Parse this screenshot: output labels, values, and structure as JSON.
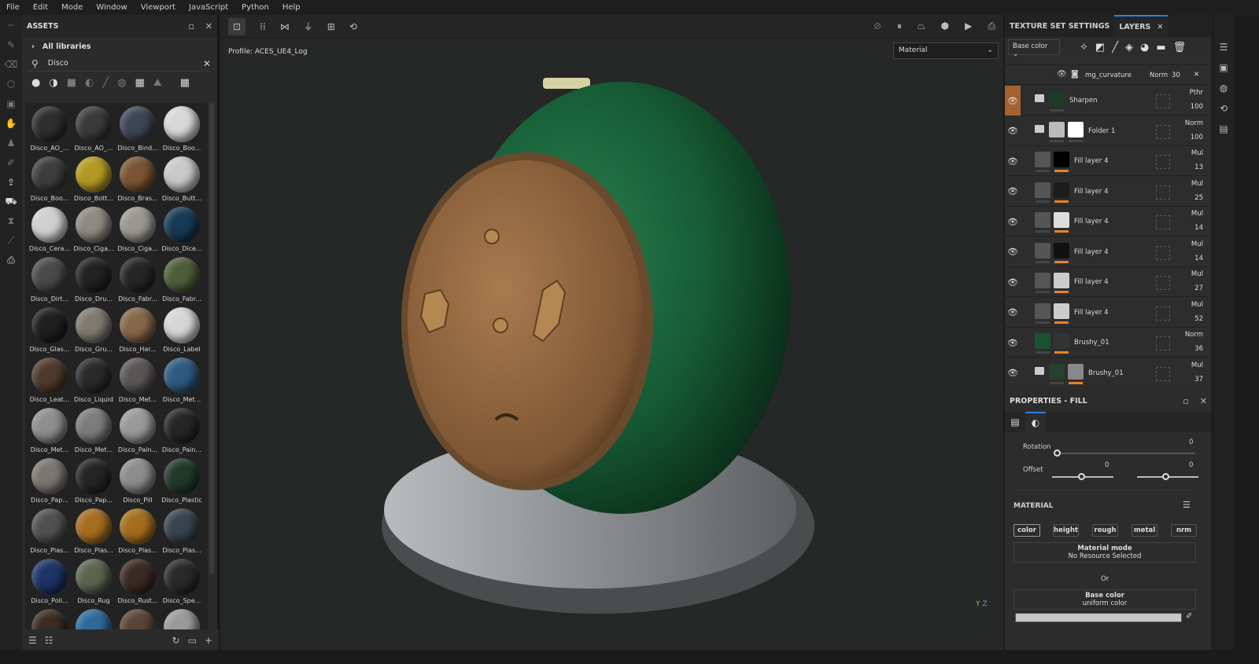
{
  "menu": [
    "File",
    "Edit",
    "Mode",
    "Window",
    "Viewport",
    "JavaScript",
    "Python",
    "Help"
  ],
  "assets": {
    "title": "ASSETS",
    "libraries": "All libraries",
    "search_value": "Disco",
    "items": [
      {
        "label": "Disco_AO_...",
        "color": "#2e2e2e"
      },
      {
        "label": "Disco_AO_...",
        "color": "#3a3a3a"
      },
      {
        "label": "Disco_Bind...",
        "color": "#3e4655"
      },
      {
        "label": "Disco_Boo...",
        "color": "#d8d8d8"
      },
      {
        "label": "Disco_Boo...",
        "color": "#3d3d3d"
      },
      {
        "label": "Disco_Bott...",
        "color": "#b39a22"
      },
      {
        "label": "Disco_Bras...",
        "color": "#7a5434"
      },
      {
        "label": "Disco_Butt...",
        "color": "#c9c9c9"
      },
      {
        "label": "Disco_Cera...",
        "color": "#d0d0d0"
      },
      {
        "label": "Disco_Ciga...",
        "color": "#8e8a82"
      },
      {
        "label": "Disco_Ciga...",
        "color": "#9b9890"
      },
      {
        "label": "Disco_Dice...",
        "color": "#163a55"
      },
      {
        "label": "Disco_Dirt...",
        "color": "#4a4a4a"
      },
      {
        "label": "Disco_Dru...",
        "color": "#222"
      },
      {
        "label": "Disco_Fabr...",
        "color": "#262626"
      },
      {
        "label": "Disco_Fabr...",
        "color": "#4e5e3a"
      },
      {
        "label": "Disco_Glas...",
        "color": "#1f1f1f"
      },
      {
        "label": "Disco_Gru...",
        "color": "#7e7a70"
      },
      {
        "label": "Disco_Har...",
        "color": "#876749"
      },
      {
        "label": "Disco_Label",
        "color": "#d6d6d6"
      },
      {
        "label": "Disco_Leat...",
        "color": "#4e3a2c"
      },
      {
        "label": "Disco_Liquid",
        "color": "#2a2a2a"
      },
      {
        "label": "Disco_Met...",
        "color": "#5b5656"
      },
      {
        "label": "Disco_Met...",
        "color": "#2e5a80"
      },
      {
        "label": "Disco_Met...",
        "color": "#8e8e8e"
      },
      {
        "label": "Disco_Met...",
        "color": "#7c7c7c"
      },
      {
        "label": "Disco_Pain...",
        "color": "#9a9a9a"
      },
      {
        "label": "Disco_Pain...",
        "color": "#262626"
      },
      {
        "label": "Disco_Pap...",
        "color": "#7a7670"
      },
      {
        "label": "Disco_Pap...",
        "color": "#252525"
      },
      {
        "label": "Disco_Pill",
        "color": "#8c8c8c"
      },
      {
        "label": "Disco_Plastic",
        "color": "#21392a"
      },
      {
        "label": "Disco_Plas...",
        "color": "#505050"
      },
      {
        "label": "Disco_Plas...",
        "color": "#a56d1f"
      },
      {
        "label": "Disco_Plas...",
        "color": "#a56d1f"
      },
      {
        "label": "Disco_Plas...",
        "color": "#38434d"
      },
      {
        "label": "Disco_Poli...",
        "color": "#1c3466"
      },
      {
        "label": "Disco_Rug",
        "color": "#5c6450"
      },
      {
        "label": "Disco_Rust...",
        "color": "#3a2a24"
      },
      {
        "label": "Disco_Spe...",
        "color": "#2a2a2a"
      },
      {
        "label": "",
        "color": "#3a2c22"
      },
      {
        "label": "",
        "color": "#2d6a9a"
      },
      {
        "label": "",
        "color": "#5a4438"
      },
      {
        "label": "",
        "color": "#9a9a9a"
      }
    ]
  },
  "viewport": {
    "profile": "Profile: ACES_UE4_Log",
    "display_mode": "Material",
    "axis_y": "Y",
    "axis_z": "Z"
  },
  "right": {
    "tab_texture": "TEXTURE SET SETTINGS",
    "tab_layers": "LAYERS",
    "channel": "Base color",
    "top_partial_opacity": "100",
    "mask_effect": {
      "name": "mg_curvature",
      "blend": "Norm",
      "opacity": "30"
    },
    "layers": [
      {
        "name": "Sharpen",
        "blend": "Pthr",
        "opacity": "100",
        "type": "folder",
        "thumb": "#1d3a24",
        "selected": true
      },
      {
        "name": "Folder 1",
        "blend": "Norm",
        "opacity": "100",
        "type": "folder2",
        "thumb": "#bbb",
        "mask": "#fff"
      },
      {
        "name": "Fill layer 4",
        "blend": "Mul",
        "opacity": "13",
        "type": "fill",
        "thumb": "#555",
        "mask": "#000"
      },
      {
        "name": "Fill layer 4",
        "blend": "Mul",
        "opacity": "25",
        "type": "fill",
        "thumb": "#555",
        "mask": "#1c1c1c"
      },
      {
        "name": "Fill layer 4",
        "blend": "Mul",
        "opacity": "14",
        "type": "fill",
        "thumb": "#555",
        "mask": "#ddd"
      },
      {
        "name": "Fill layer 4",
        "blend": "Mul",
        "opacity": "14",
        "type": "fill",
        "thumb": "#555",
        "mask": "#111"
      },
      {
        "name": "Fill layer 4",
        "blend": "Mul",
        "opacity": "27",
        "type": "fill",
        "thumb": "#555",
        "mask": "#ccc"
      },
      {
        "name": "Fill layer 4",
        "blend": "Mul",
        "opacity": "52",
        "type": "fill",
        "thumb": "#555",
        "mask": "#ccc"
      },
      {
        "name": "Brushy_01",
        "blend": "Norm",
        "opacity": "36",
        "type": "fill",
        "thumb": "#1a5230",
        "mask": "#333"
      },
      {
        "name": "Brushy_01",
        "blend": "Mul",
        "opacity": "37",
        "type": "folder2",
        "thumb": "#24402e",
        "mask": "#888"
      }
    ],
    "properties": {
      "title": "PROPERTIES - FILL",
      "rotation_label": "Rotation",
      "rotation_value": "0",
      "offset_label": "Offset",
      "offset_x": "0",
      "offset_y": "0",
      "material_title": "MATERIAL",
      "channels": [
        "color",
        "height",
        "rough",
        "metal",
        "nrm"
      ],
      "material_mode": "Material mode",
      "no_resource": "No Resource Selected",
      "or": "Or",
      "base_color": "Base color",
      "uniform_color": "uniform color",
      "color_value": "#c8c8c8"
    }
  }
}
